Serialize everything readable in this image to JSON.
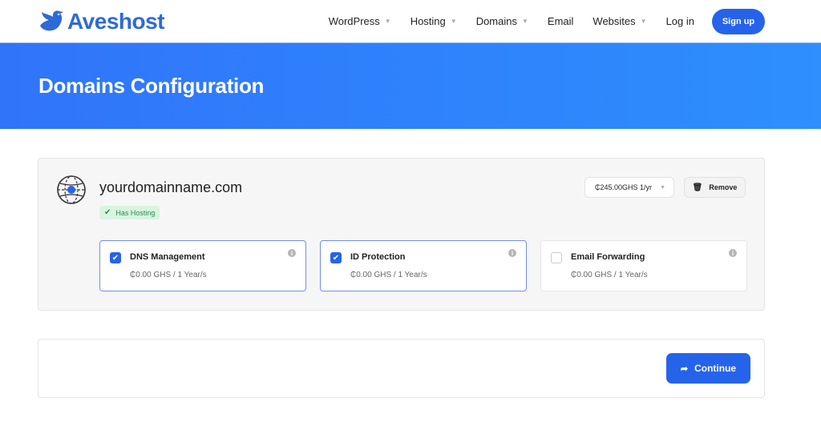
{
  "brand": {
    "name": "Aveshost",
    "color": "#2d6ad8"
  },
  "nav": {
    "items": [
      {
        "label": "WordPress",
        "dropdown": true
      },
      {
        "label": "Hosting",
        "dropdown": true
      },
      {
        "label": "Domains",
        "dropdown": true
      },
      {
        "label": "Email",
        "dropdown": false
      },
      {
        "label": "Websites",
        "dropdown": true
      },
      {
        "label": "Log in",
        "dropdown": false
      }
    ],
    "signup_label": "Sign up",
    "caret": "▼"
  },
  "hero": {
    "title": "Domains Configuration"
  },
  "domain": {
    "name": "yourdomainname.com",
    "badge_icon": "check-icon",
    "badge_label": "Has Hosting",
    "price_selected": "₵245.00GHS 1/yr",
    "remove_label": "Remove",
    "addons": [
      {
        "title": "DNS Management",
        "price": "₵0.00 GHS / 1 Year/s",
        "checked": true
      },
      {
        "title": "ID Protection",
        "price": "₵0.00 GHS / 1 Year/s",
        "checked": true
      },
      {
        "title": "Email Forwarding",
        "price": "₵0.00 GHS / 1 Year/s",
        "checked": false
      }
    ]
  },
  "footer": {
    "continue_label": "Continue"
  },
  "colors": {
    "accent": "#2563eb",
    "hero_start": "#3074fa",
    "hero_end": "#2e8ffd",
    "badge_bg": "#d9f4df",
    "badge_text": "#2e8b49"
  }
}
